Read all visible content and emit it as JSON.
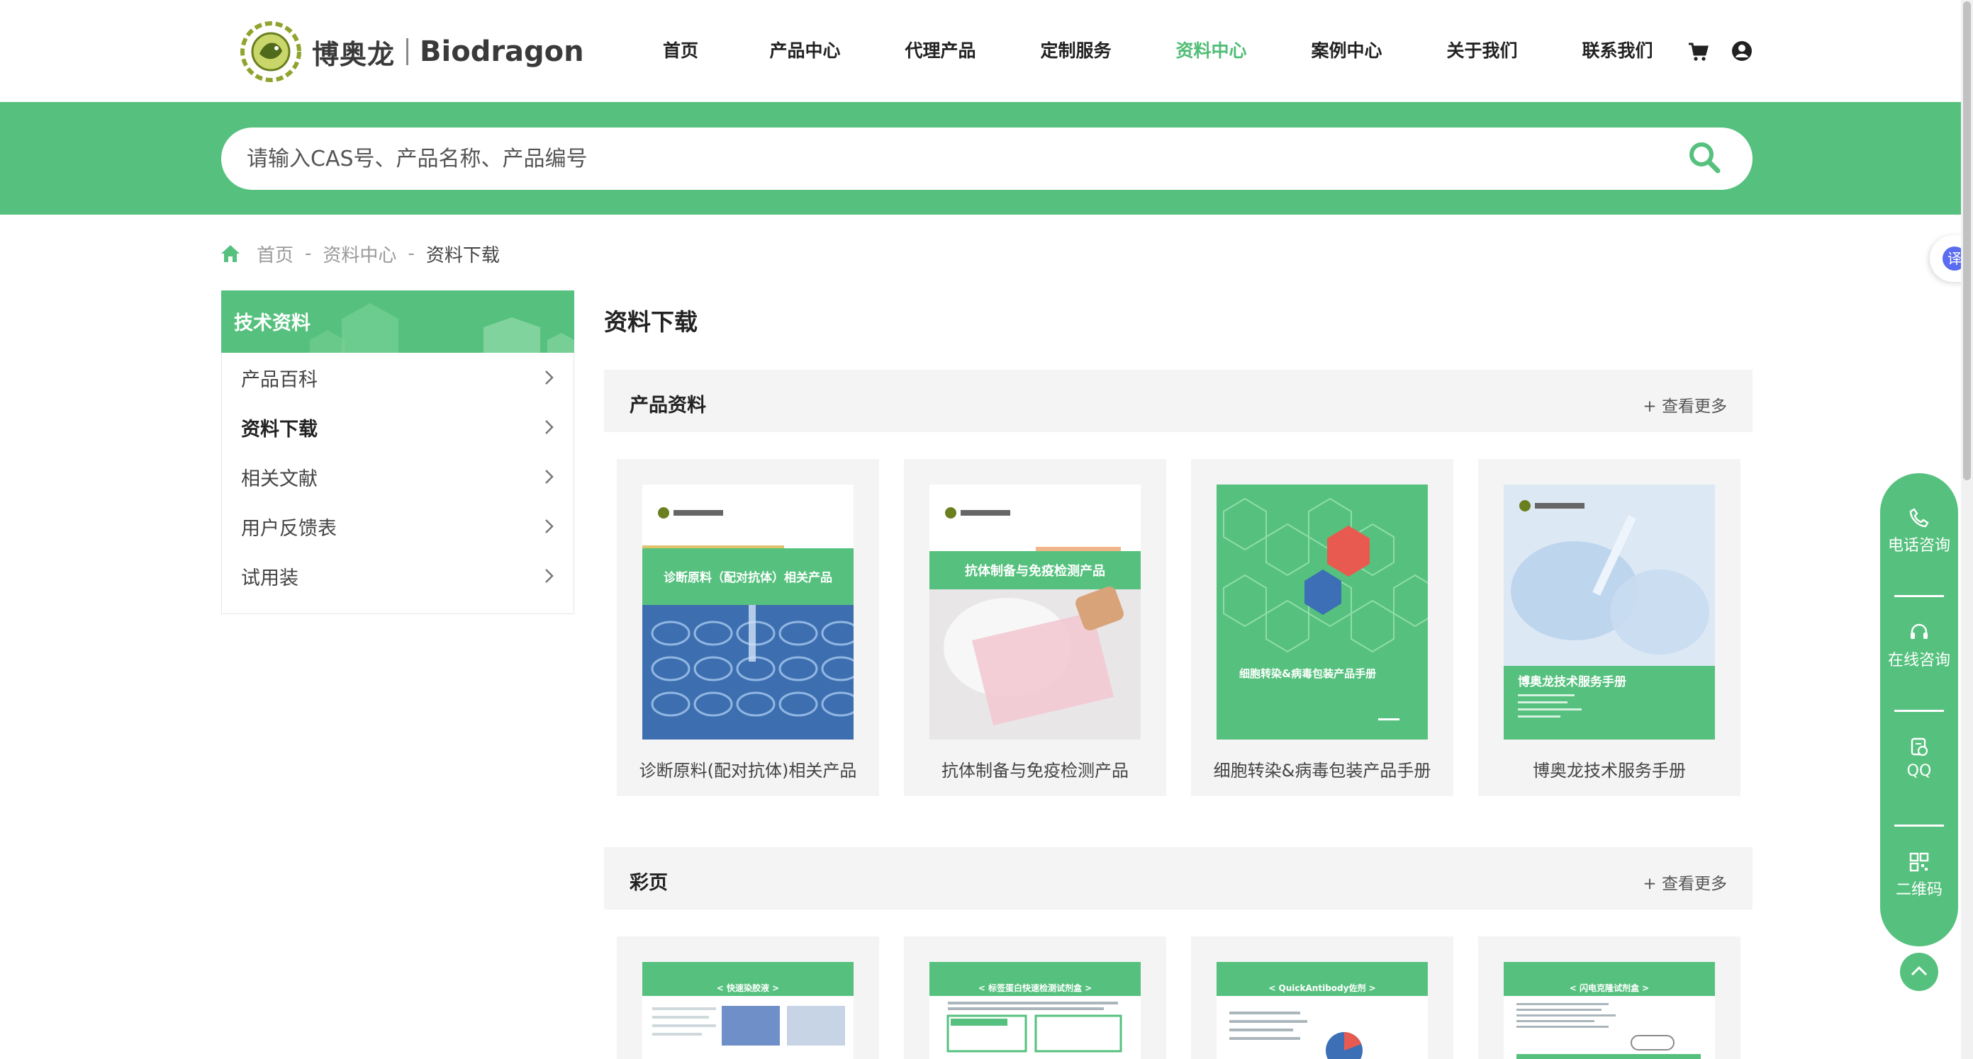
{
  "brand": {
    "name_cn": "博奥龙",
    "name_en": "Biodragon"
  },
  "nav": {
    "items": [
      {
        "label": "首页",
        "active": false
      },
      {
        "label": "产品中心",
        "active": false
      },
      {
        "label": "代理产品",
        "active": false
      },
      {
        "label": "定制服务",
        "active": false
      },
      {
        "label": "资料中心",
        "active": true
      },
      {
        "label": "案例中心",
        "active": false
      },
      {
        "label": "关于我们",
        "active": false
      },
      {
        "label": "联系我们",
        "active": false
      }
    ]
  },
  "search": {
    "placeholder": "请输入CAS号、产品名称、产品编号"
  },
  "breadcrumb": {
    "home": "首页",
    "sep": "-",
    "level1": "资料中心",
    "current": "资料下载"
  },
  "sidebar": {
    "title": "技术资料",
    "items": [
      {
        "label": "产品百科",
        "active": false
      },
      {
        "label": "资料下载",
        "active": true
      },
      {
        "label": "相关文献",
        "active": false
      },
      {
        "label": "用户反馈表",
        "active": false
      },
      {
        "label": "试用装",
        "active": false
      }
    ]
  },
  "main": {
    "title": "资料下载",
    "sections": [
      {
        "title": "产品资料",
        "more": "+ 查看更多",
        "cards": [
          {
            "caption": "诊断原料(配对抗体)相关产品",
            "cover_title": "诊断原料（配对抗体）相关产品"
          },
          {
            "caption": "抗体制备与免疫检测产品",
            "cover_title": "抗体制备与免疫检测产品"
          },
          {
            "caption": "细胞转染&病毒包装产品手册",
            "cover_title": "细胞转染&病毒包装产品手册"
          },
          {
            "caption": "博奥龙技术服务手册",
            "cover_title": "博奥龙技术服务手册"
          }
        ]
      },
      {
        "title": "彩页",
        "more": "+ 查看更多",
        "cards": [
          {
            "cover_title": "< 快速染胶液 >"
          },
          {
            "cover_title": "< 标签蛋白快速检测试剂盒 >"
          },
          {
            "cover_title": "< QuickAntibody佐剂 >"
          },
          {
            "cover_title": "< 闪电克隆试剂盒 >"
          }
        ]
      }
    ]
  },
  "float_bar": {
    "items": [
      {
        "label": "电话咨询",
        "icon": "phone-icon"
      },
      {
        "label": "在线咨询",
        "icon": "headset-icon"
      },
      {
        "label": "QQ",
        "icon": "qq-icon"
      },
      {
        "label": "二维码",
        "icon": "qrcode-icon"
      }
    ]
  },
  "translate": {
    "label": "译"
  },
  "colors": {
    "brand_green": "#56c17e",
    "active_nav": "#50bd75",
    "card_bg": "#f4f4f4"
  }
}
